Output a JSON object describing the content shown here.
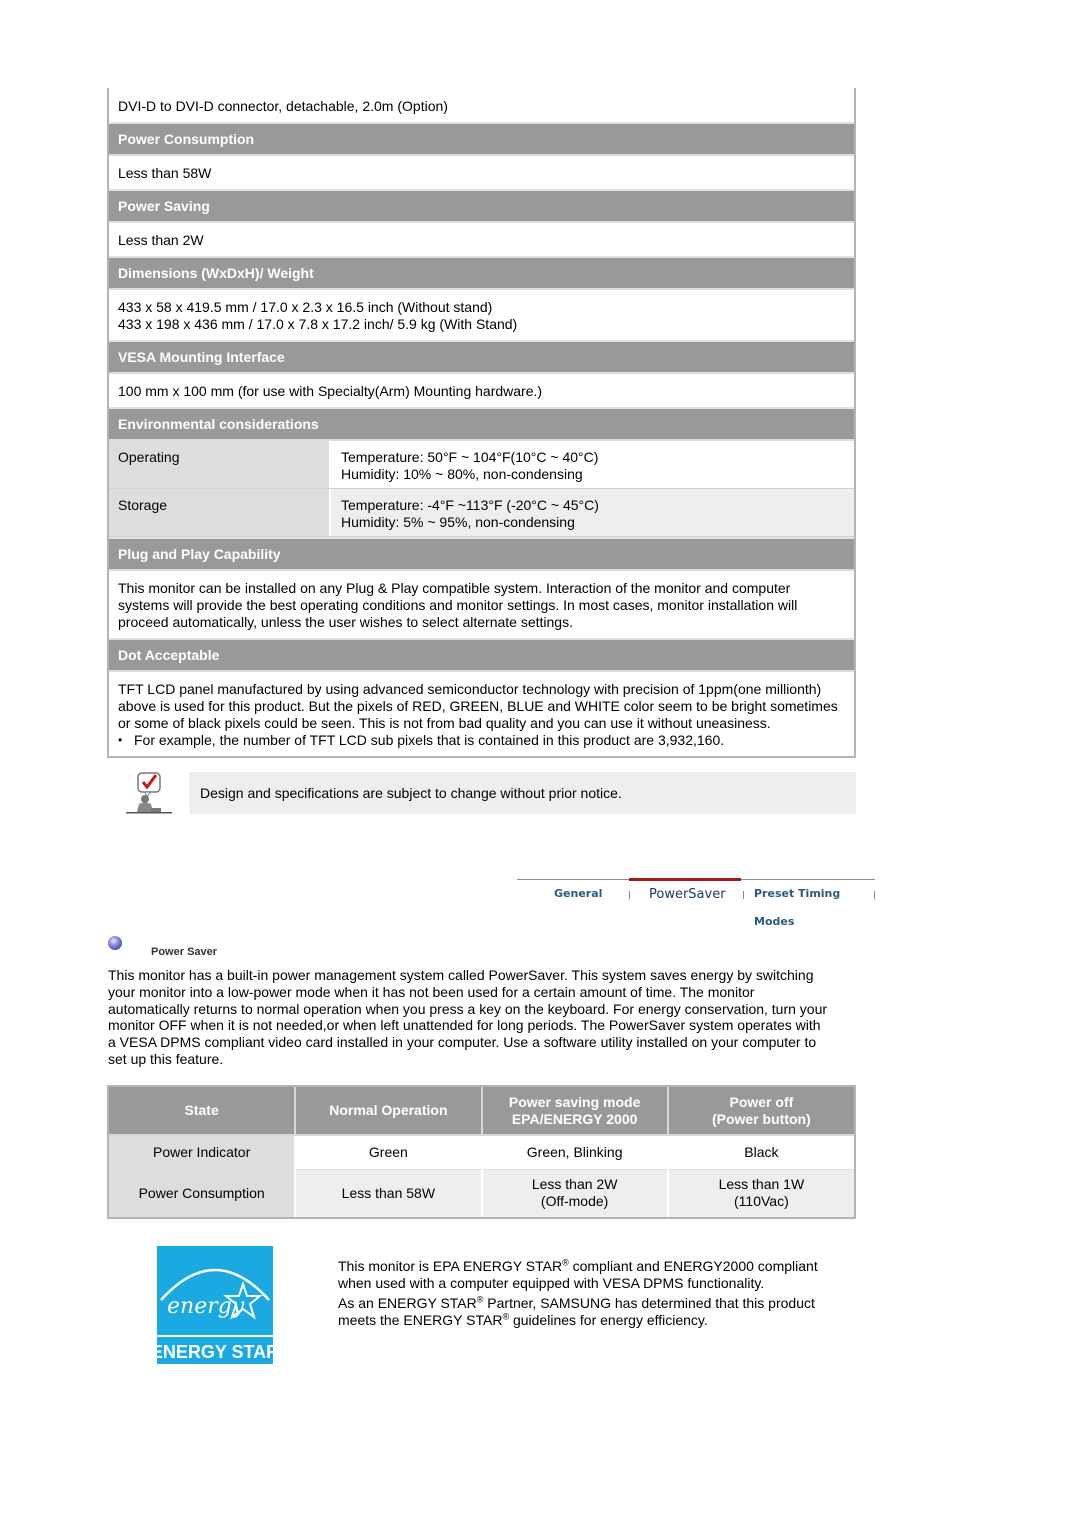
{
  "spec": {
    "connector_text": "DVI-D to DVI-D connector, detachable, 2.0m (Option)",
    "sections": {
      "power_consumption": {
        "title": "Power Consumption",
        "value": "Less than 58W"
      },
      "power_saving": {
        "title": "Power Saving",
        "value": "Less than 2W"
      },
      "dimensions": {
        "title": "Dimensions (WxDxH)/ Weight",
        "lines": [
          "433 x 58 x 419.5 mm / 17.0 x 2.3 x 16.5 inch (Without stand)",
          "433 x 198 x 436 mm / 17.0 x 7.8 x 17.2 inch/ 5.9 kg (With Stand)"
        ]
      },
      "vesa": {
        "title": "VESA Mounting Interface",
        "value": "100 mm x 100 mm (for use with Specialty(Arm) Mounting hardware.)"
      },
      "environment": {
        "title": "Environmental considerations",
        "rows": [
          {
            "label": "Operating",
            "lines": [
              "Temperature: 50°F ~ 104°F(10°C ~ 40°C)",
              "Humidity: 10% ~ 80%, non-condensing"
            ]
          },
          {
            "label": "Storage",
            "lines": [
              "Temperature: -4°F ~113°F (-20°C ~ 45°C)",
              "Humidity: 5% ~ 95%, non-condensing"
            ]
          }
        ]
      },
      "plug_and_play": {
        "title": "Plug and Play Capability",
        "value": "This monitor can be installed on any Plug & Play compatible system. Interaction of the monitor and computer systems will provide the best operating conditions and monitor settings. In most cases, monitor installation will proceed automatically, unless the user wishes to select alternate settings."
      },
      "dot_acceptable": {
        "title": "Dot Acceptable",
        "value": "TFT LCD panel manufactured by using advanced semiconductor technology with precision of 1ppm(one millionth) above is used for this product. But the pixels of RED, GREEN, BLUE and WHITE color seem to be bright sometimes or some of black pixels could be seen. This is not from bad quality and you can use it without uneasiness.",
        "bullet": "For example, the number of TFT LCD sub pixels that is contained in this product are 3,932,160.",
        "bullet_glyph": "•"
      }
    }
  },
  "note": {
    "icon": "checklist-person-icon",
    "text": "Design and specifications are subject to change without prior notice."
  },
  "tabs": {
    "items": [
      {
        "label": "General",
        "active": false
      },
      {
        "label": "PowerSaver",
        "active": true
      },
      {
        "label": "Preset Timing Modes",
        "active": false
      }
    ],
    "active_color": "#a11a1a"
  },
  "power_saver": {
    "heading": "Power Saver",
    "bullet_icon": "orb-bullet-icon",
    "paragraph": "This monitor has a built-in power management system called PowerSaver. This system saves energy by switching your monitor into a low-power mode when it has not been used for a certain amount of time. The monitor automatically returns to normal operation when you press a key on the keyboard. For energy conservation, turn your monitor OFF when it is not needed,or when left unattended for long periods. The PowerSaver system operates with a VESA DPMS compliant video card installed in your computer. Use a software utility installed on your computer to set up this feature."
  },
  "power_table": {
    "headers": [
      {
        "line1": "State",
        "line2": ""
      },
      {
        "line1": "Normal Operation",
        "line2": ""
      },
      {
        "line1": "Power saving mode",
        "line2": "EPA/ENERGY 2000"
      },
      {
        "line1": "Power off",
        "line2": "(Power button)"
      }
    ],
    "rows": [
      {
        "cells": [
          {
            "line1": "Power Indicator",
            "line2": ""
          },
          {
            "line1": "Green",
            "line2": ""
          },
          {
            "line1": "Green, Blinking",
            "line2": ""
          },
          {
            "line1": "Black",
            "line2": ""
          }
        ]
      },
      {
        "cells": [
          {
            "line1": "Power Consumption",
            "line2": ""
          },
          {
            "line1": "Less than 58W",
            "line2": ""
          },
          {
            "line1": "Less than 2W",
            "line2": "(Off-mode)"
          },
          {
            "line1": "Less than 1W",
            "line2": "(110Vac)"
          }
        ]
      }
    ]
  },
  "energy_star": {
    "logo_script": "energy",
    "logo_label": "ENERGY STAR",
    "logo_color": "#1ba9e1",
    "para1_a": "This monitor is EPA ENERGY STAR",
    "para1_b": " compliant and ENERGY2000 compliant when used with a computer equipped with VESA DPMS functionality.",
    "para2_a": "As an ENERGY STAR",
    "para2_b": " Partner, SAMSUNG has determined that this product meets the ENERGY STAR",
    "para2_c": " guidelines for energy efficiency.",
    "reg_mark": "®"
  }
}
